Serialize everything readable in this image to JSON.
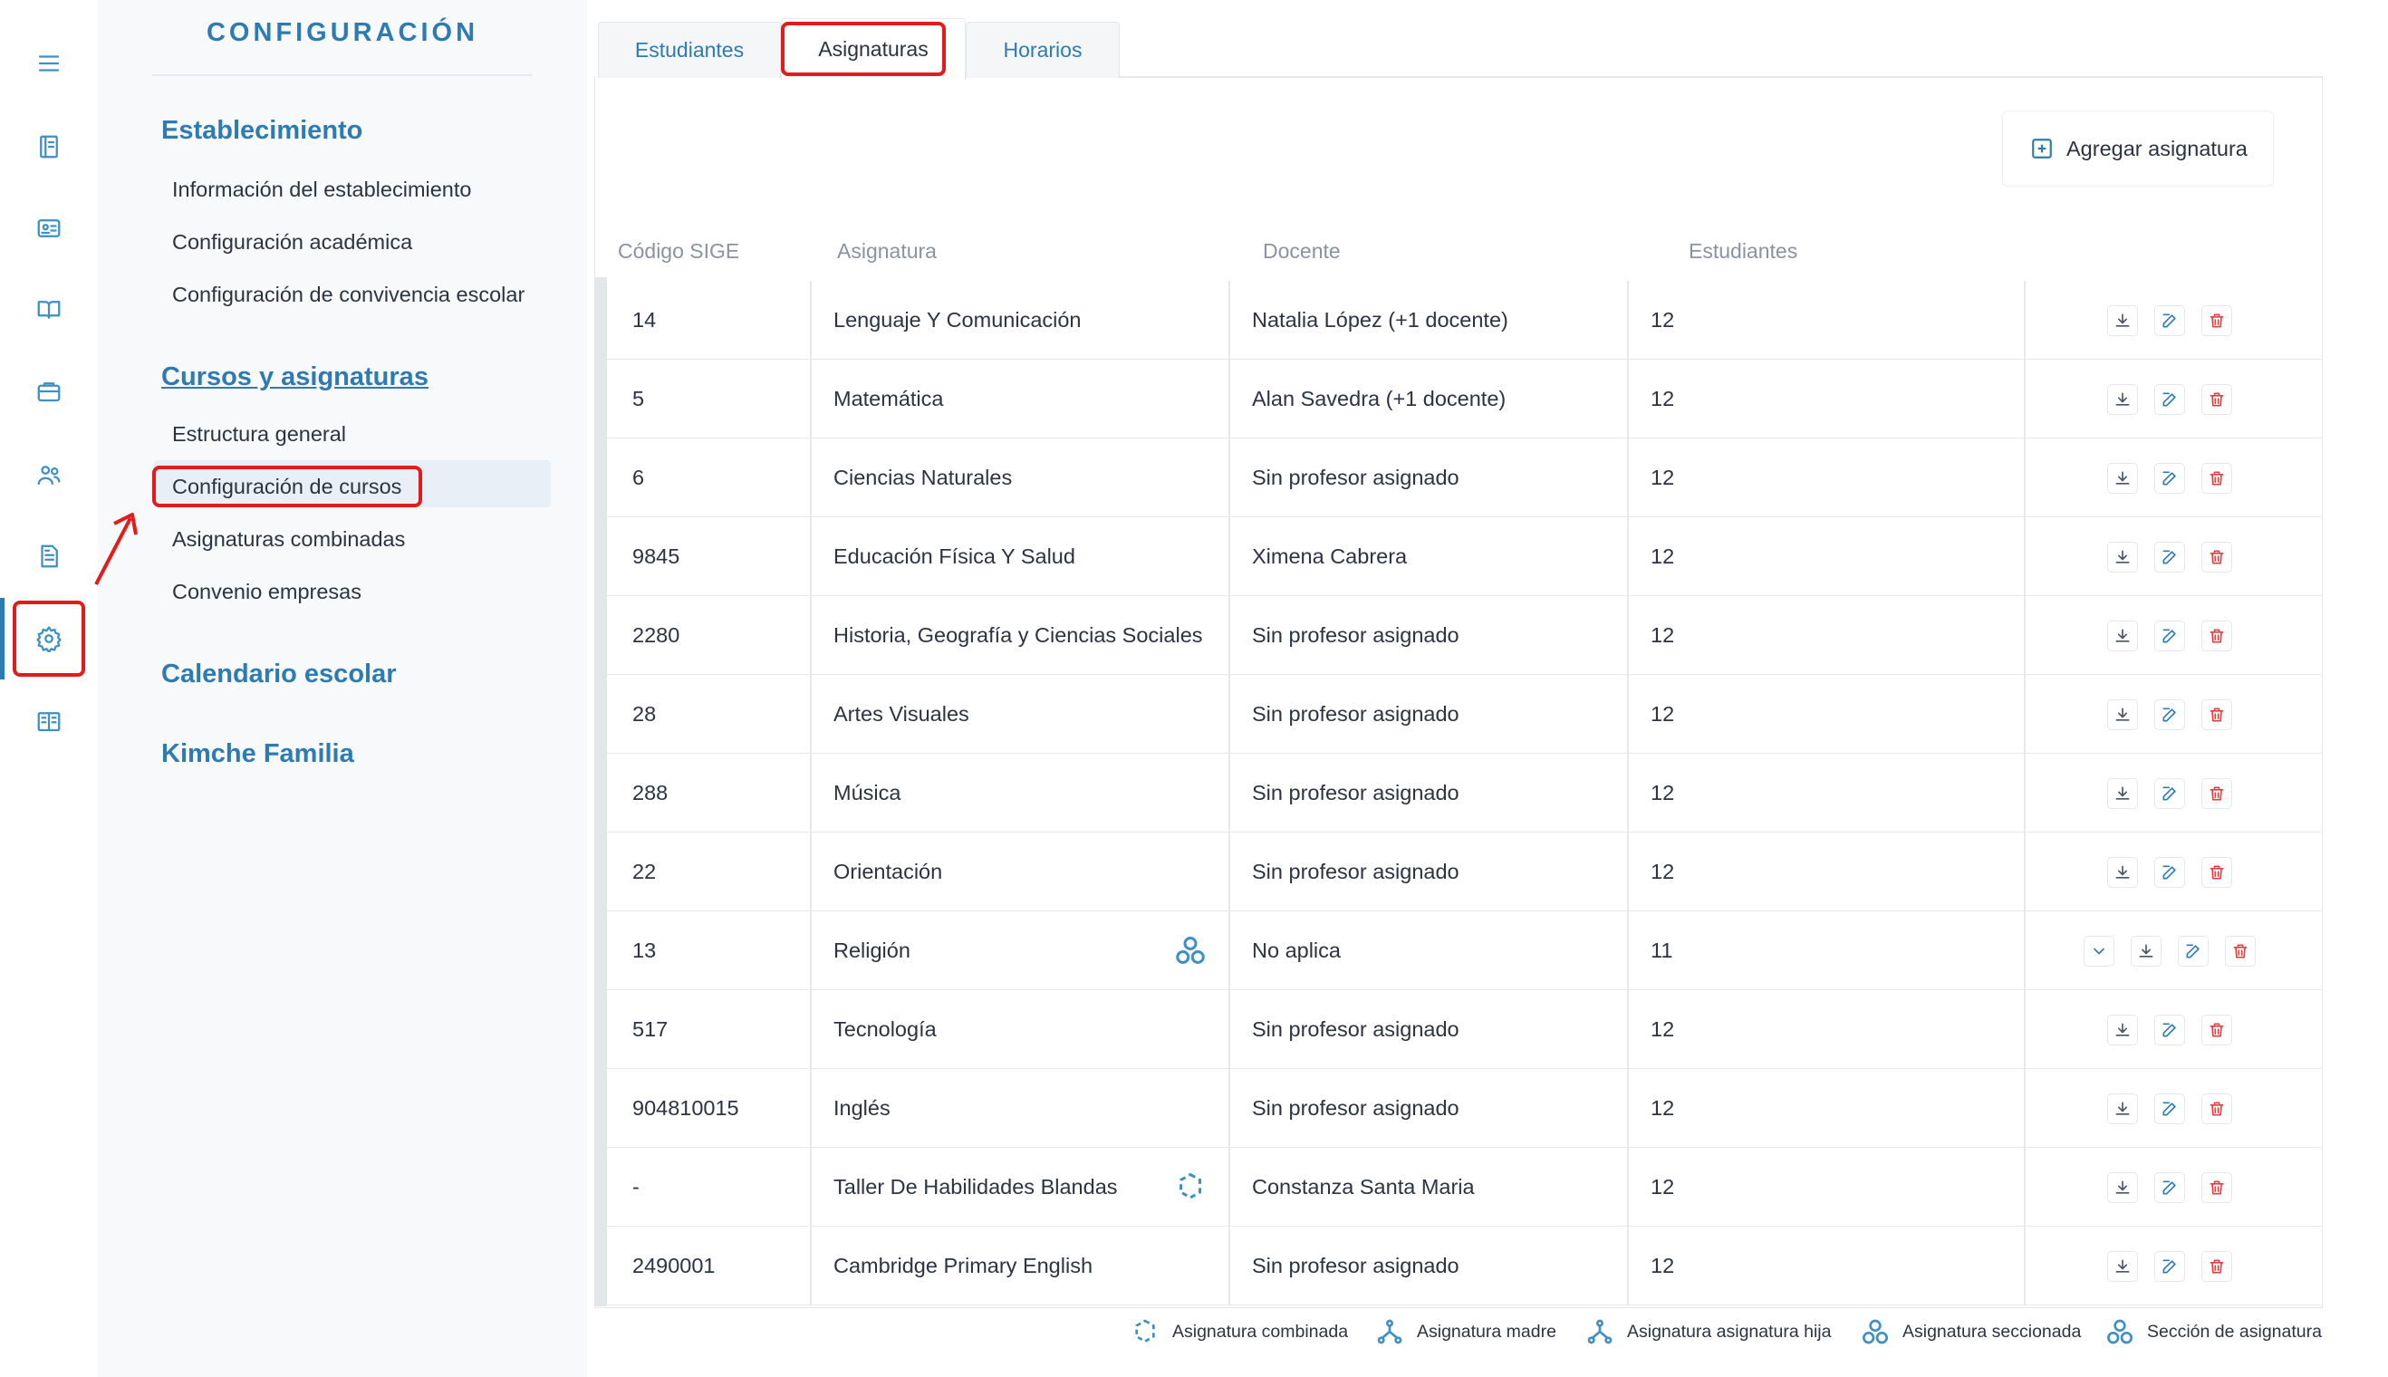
{
  "sidebar_icons": [
    "menu-icon",
    "notebook-icon",
    "id-card-icon",
    "book-open-icon",
    "briefcase-icon",
    "users-icon",
    "document-icon",
    "settings-icon",
    "library-icon"
  ],
  "panel": {
    "title": "CONFIGURACIÓN",
    "sections": [
      {
        "label": "Establecimiento",
        "items": [
          "Información del establecimiento",
          "Configuración académica",
          "Configuración de convivencia escolar"
        ]
      },
      {
        "label": "Cursos y asignaturas",
        "items": [
          "Estructura general",
          "Configuración de cursos",
          "Asignaturas combinadas",
          "Convenio empresas"
        ]
      },
      {
        "label": "Calendario escolar",
        "items": []
      },
      {
        "label": "Kimche Familia",
        "items": []
      }
    ]
  },
  "tabs": [
    "Estudiantes",
    "Asignaturas",
    "Horarios"
  ],
  "add_button": "Agregar asignatura",
  "columns": [
    "Código SIGE",
    "Asignatura",
    "Docente",
    "Estudiantes"
  ],
  "rows": [
    {
      "code": "14",
      "subject": "Lenguaje Y Comunicación",
      "teacher": "Natalia López (+1 docente)",
      "students": "12"
    },
    {
      "code": "5",
      "subject": "Matemática",
      "teacher": "Alan Savedra (+1 docente)",
      "students": "12"
    },
    {
      "code": "6",
      "subject": "Ciencias Naturales",
      "teacher": "Sin profesor asignado",
      "students": "12"
    },
    {
      "code": "9845",
      "subject": "Educación Física Y Salud",
      "teacher": "Ximena Cabrera",
      "students": "12"
    },
    {
      "code": "2280",
      "subject": "Historia, Geografía y Ciencias Sociales",
      "teacher": "Sin profesor asignado",
      "students": "12"
    },
    {
      "code": "28",
      "subject": "Artes Visuales",
      "teacher": "Sin profesor asignado",
      "students": "12"
    },
    {
      "code": "288",
      "subject": "Música",
      "teacher": "Sin profesor asignado",
      "students": "12"
    },
    {
      "code": "22",
      "subject": "Orientación",
      "teacher": "Sin profesor asignado",
      "students": "12"
    },
    {
      "code": "13",
      "subject": "Religión",
      "teacher": "No aplica",
      "students": "11",
      "icon": "seccionada"
    },
    {
      "code": "517",
      "subject": "Tecnología",
      "teacher": "Sin profesor asignado",
      "students": "12"
    },
    {
      "code": "904810015",
      "subject": "Inglés",
      "teacher": "Sin profesor asignado",
      "students": "12"
    },
    {
      "code": "-",
      "subject": "Taller De Habilidades Blandas",
      "teacher": "Constanza Santa Maria",
      "students": "12",
      "icon": "combinada"
    },
    {
      "code": "2490001",
      "subject": "Cambridge Primary English",
      "teacher": "Sin profesor asignado",
      "students": "12"
    }
  ],
  "legend": [
    "Asignatura combinada",
    "Asignatura madre",
    "Asignatura asignatura hija",
    "Asignatura seccionada",
    "Sección de asignatura"
  ],
  "colors": {
    "accent": "#2e7bb4",
    "highlight": "#e41b1b",
    "delete": "#e24040"
  }
}
